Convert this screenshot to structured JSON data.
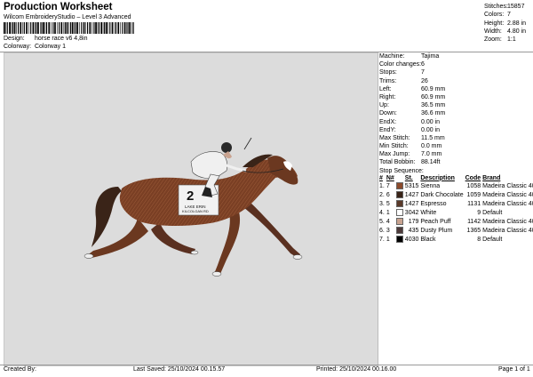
{
  "header": {
    "title": "Production Worksheet",
    "subtitle": "Wilcom EmbroideryStudio – Level 3 Advanced",
    "design_label": "Design:",
    "design_value": "horse race v6 4,8in",
    "colorway_label": "Colorway:",
    "colorway_value": "Colorway 1"
  },
  "stats": [
    {
      "label": "Stitches:",
      "value": "15857"
    },
    {
      "label": "Colors:",
      "value": "7"
    },
    {
      "label": "Height:",
      "value": "2.88 in"
    },
    {
      "label": "Width:",
      "value": "4.80 in"
    },
    {
      "label": "Zoom:",
      "value": "1:1"
    }
  ],
  "info": [
    {
      "label": "Machine:",
      "value": "Tajima"
    },
    {
      "label": "Color changes:",
      "value": "6"
    },
    {
      "label": "Stops:",
      "value": "7"
    },
    {
      "label": "Trims:",
      "value": "26"
    },
    {
      "label": "Left:",
      "value": "60.9 mm"
    },
    {
      "label": "Right:",
      "value": "60.9 mm"
    },
    {
      "label": "Up:",
      "value": "36.5 mm"
    },
    {
      "label": "Down:",
      "value": "36.6 mm"
    },
    {
      "label": "EndX:",
      "value": "0.00 in"
    },
    {
      "label": "EndY:",
      "value": "0.00 in"
    },
    {
      "label": "Max Stitch:",
      "value": "11.5 mm"
    },
    {
      "label": "Min Stitch:",
      "value": "0.0 mm"
    },
    {
      "label": "Max Jump:",
      "value": "7.0 mm"
    },
    {
      "label": "Total Bobbin:",
      "value": "88.14ft"
    }
  ],
  "stop_sequence": {
    "title": "Stop Sequence:",
    "headers": [
      "#",
      "N#",
      "",
      "St.",
      "Description",
      "Code",
      "Brand"
    ],
    "rows": [
      {
        "num": "1.",
        "n": "7",
        "color": "#8b4a2b",
        "st": "5315",
        "desc": "Sienna",
        "code": "1058",
        "brand": "Madeira Classic 40"
      },
      {
        "num": "2.",
        "n": "6",
        "color": "#3a2418",
        "st": "1427",
        "desc": "Dark Chocolate",
        "code": "1059",
        "brand": "Madeira Classic 40"
      },
      {
        "num": "3.",
        "n": "5",
        "color": "#5a3a2a",
        "st": "1427",
        "desc": "Espresso",
        "code": "1131",
        "brand": "Madeira Classic 40"
      },
      {
        "num": "4.",
        "n": "1",
        "color": "#ffffff",
        "st": "3042",
        "desc": "White",
        "code": "9",
        "brand": "Default"
      },
      {
        "num": "5.",
        "n": "4",
        "color": "#c9a390",
        "st": "179",
        "desc": "Peach Puff",
        "code": "1142",
        "brand": "Madeira Classic 40"
      },
      {
        "num": "6.",
        "n": "3",
        "color": "#4d3a3a",
        "st": "435",
        "desc": "Dusty Plum",
        "code": "1365",
        "brand": "Madeira Classic 40"
      },
      {
        "num": "7.",
        "n": "1",
        "color": "#000000",
        "st": "4030",
        "desc": "Black",
        "code": "8",
        "brand": "Default"
      }
    ]
  },
  "design_art": {
    "saddle_number": "2",
    "saddle_text": "LAKE ERIN",
    "saddle_text2": "KILCOLGAN RD"
  },
  "footer": {
    "created_by": "Created By:",
    "last_saved": "Last Saved: 25/10/2024 00.15.57",
    "printed": "Printed: 25/10/2024 00.16.00",
    "page": "Page 1 of 1"
  }
}
